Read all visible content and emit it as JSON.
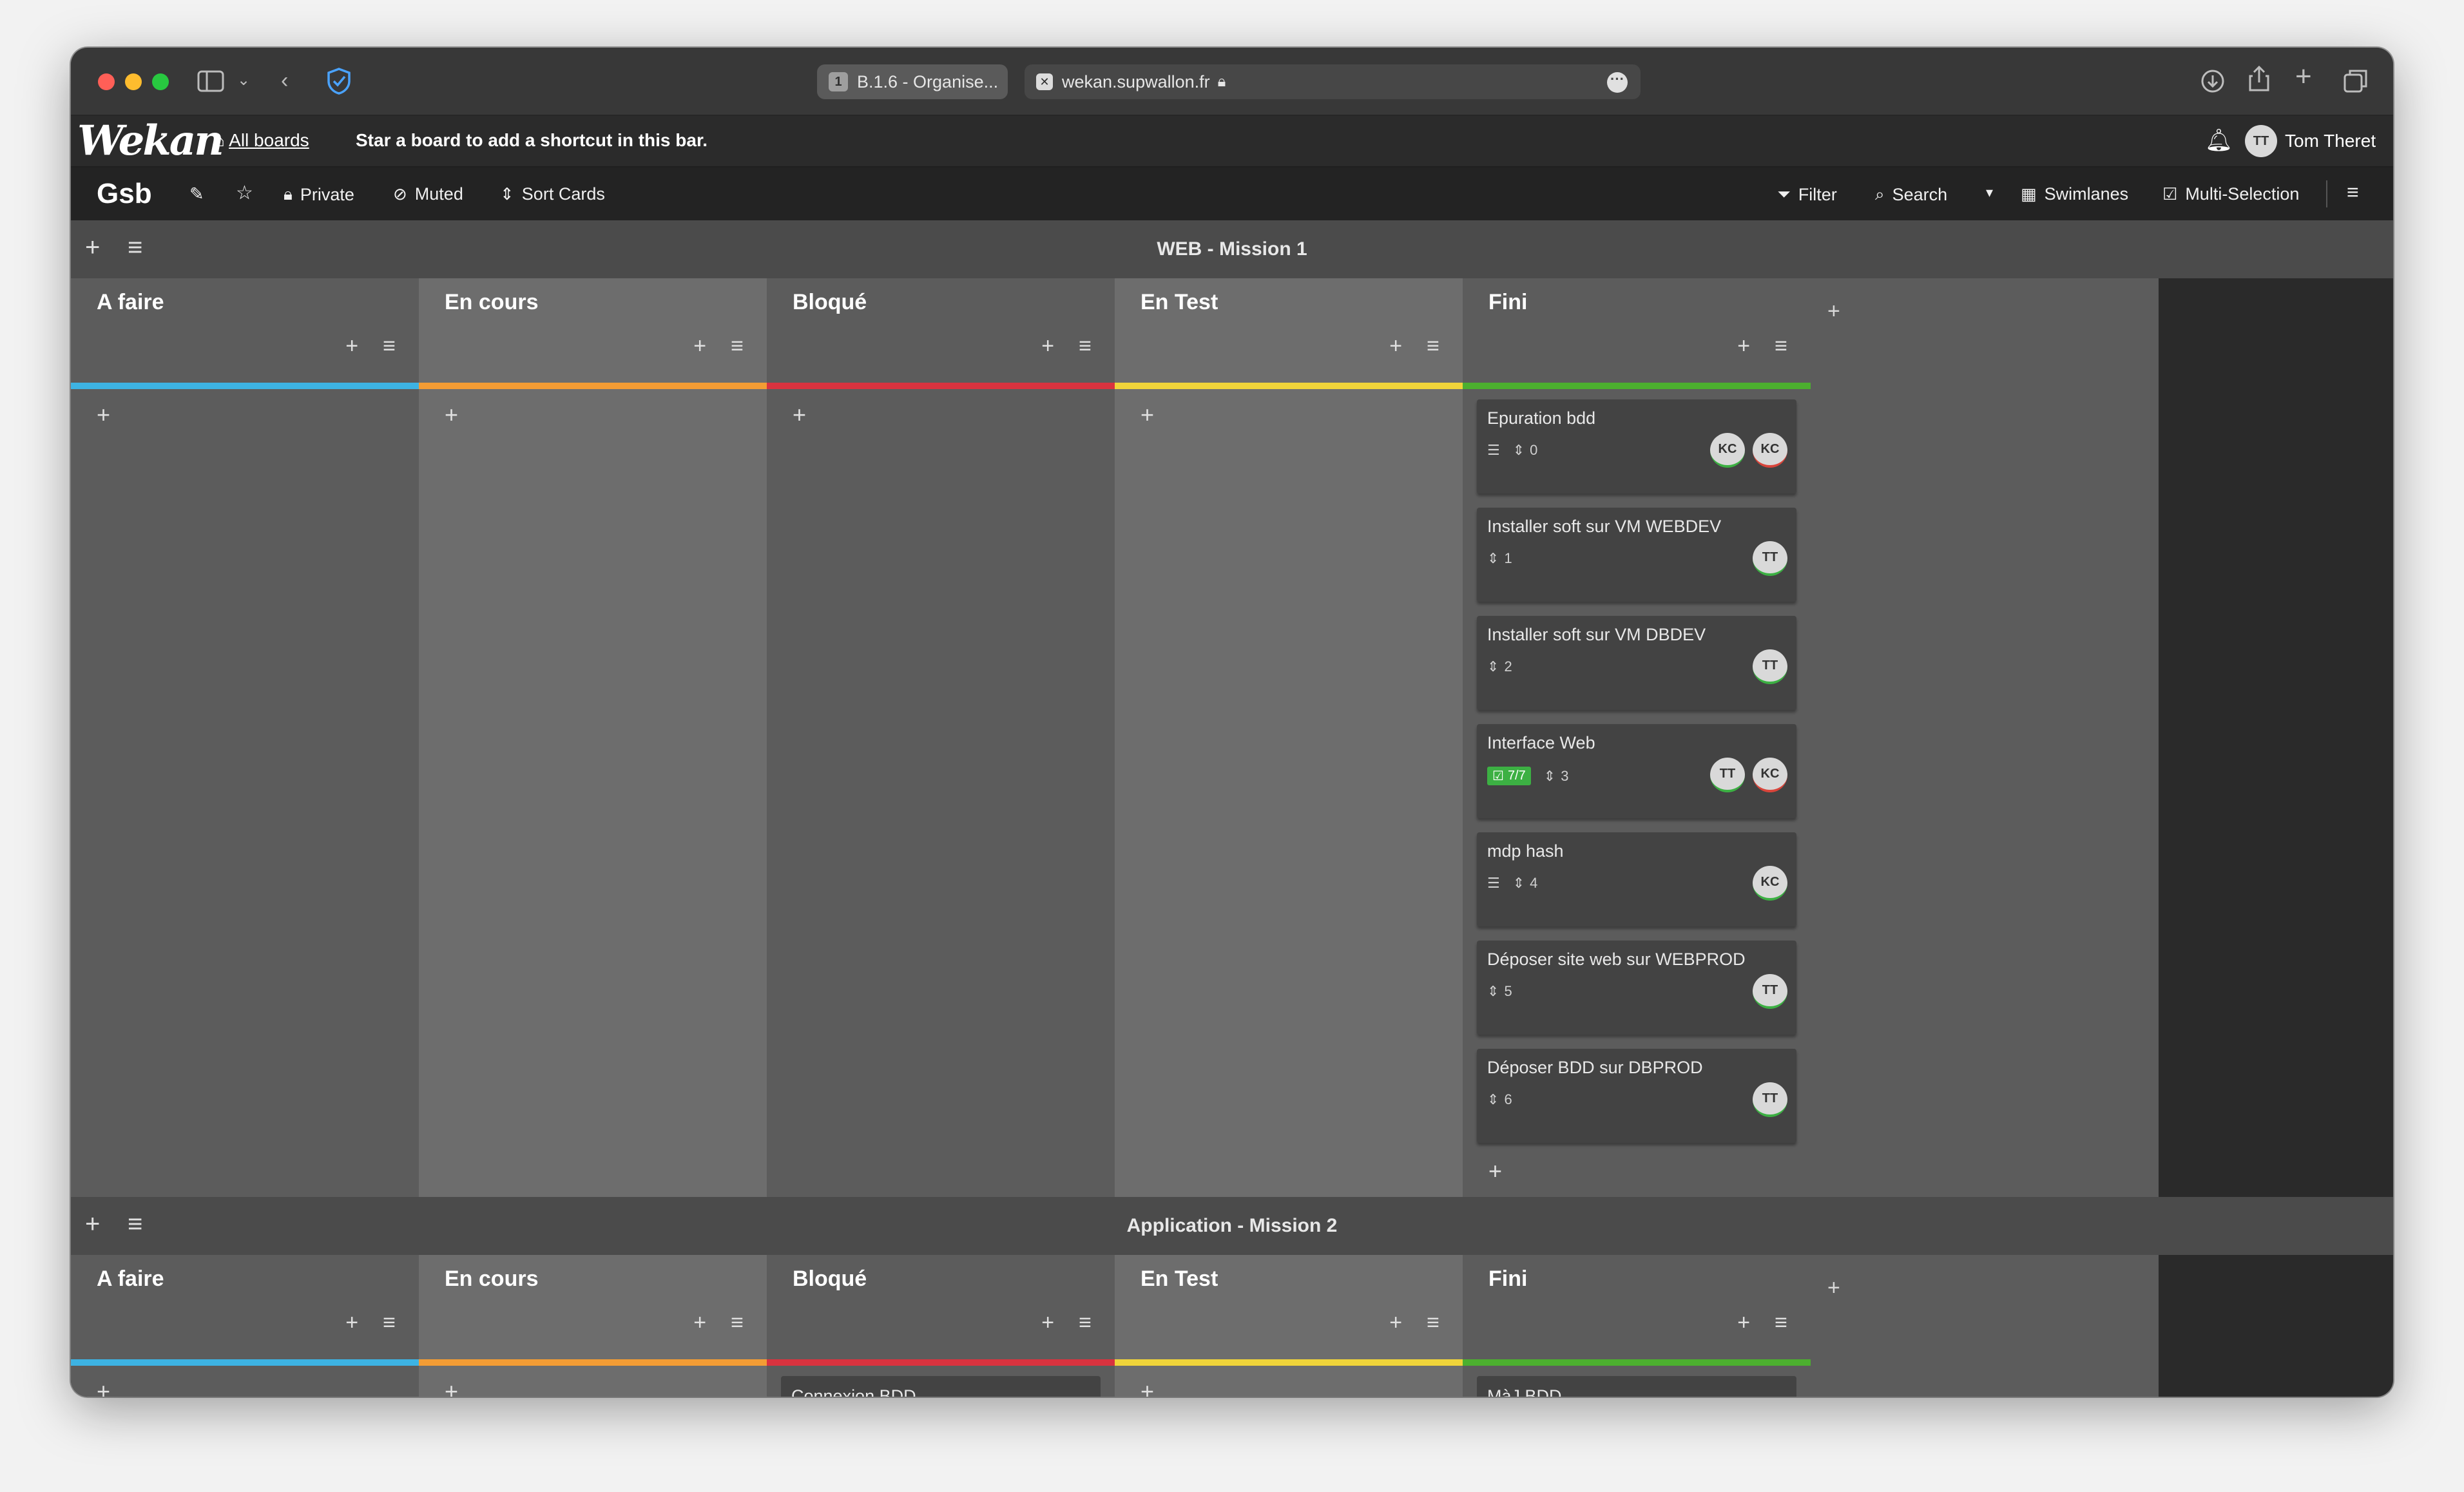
{
  "browser": {
    "tab_active_badge": "1",
    "tab_active_label": "B.1.6 - Organise...",
    "address": "wekan.supwallon.fr"
  },
  "header": {
    "all_boards_label": "All boards",
    "star_hint": "Star a board to add a shortcut in this bar.",
    "user_initials": "TT",
    "user_name": "Tom Theret"
  },
  "board": {
    "title": "Gsb",
    "private_label": "Private",
    "muted_label": "Muted",
    "sort_label": "Sort Cards",
    "filter_label": "Filter",
    "search_label": "Search",
    "swimlanes_label": "Swimlanes",
    "multiselect_label": "Multi-Selection"
  },
  "colors": {
    "a_faire": "#3db3e3",
    "en_cours": "#f39c34",
    "bloque": "#d9333f",
    "en_test": "#f0d43a",
    "fini": "#4caf2f"
  },
  "lists": [
    "A faire",
    "En cours",
    "Bloqué",
    "En Test",
    "Fini"
  ],
  "swimlanes": [
    {
      "title": "WEB - Mission 1",
      "fini_cards": [
        {
          "title": "Epuration bdd",
          "has_description": true,
          "sort": "0",
          "checklist": "",
          "members": [
            "KC",
            "KC"
          ]
        },
        {
          "title": "Installer soft sur VM WEBDEV",
          "has_description": false,
          "sort": "1",
          "checklist": "",
          "members": [
            "TT"
          ]
        },
        {
          "title": "Installer soft sur VM DBDEV",
          "has_description": false,
          "sort": "2",
          "checklist": "",
          "members": [
            "TT"
          ]
        },
        {
          "title": "Interface Web",
          "has_description": false,
          "sort": "3",
          "checklist": "7/7",
          "members": [
            "TT",
            "KC"
          ]
        },
        {
          "title": "mdp hash",
          "has_description": true,
          "sort": "4",
          "checklist": "",
          "members": [
            "KC"
          ]
        },
        {
          "title": "Déposer site web sur WEBPROD",
          "has_description": false,
          "sort": "5",
          "checklist": "",
          "members": [
            "TT"
          ]
        },
        {
          "title": "Déposer BDD sur DBPROD",
          "has_description": false,
          "sort": "6",
          "checklist": "",
          "members": [
            "TT"
          ]
        }
      ]
    },
    {
      "title": "Application - Mission 2",
      "bloque_partial_card": "Connexion BDD",
      "fini_partial_card": "MàJ BDD"
    }
  ]
}
